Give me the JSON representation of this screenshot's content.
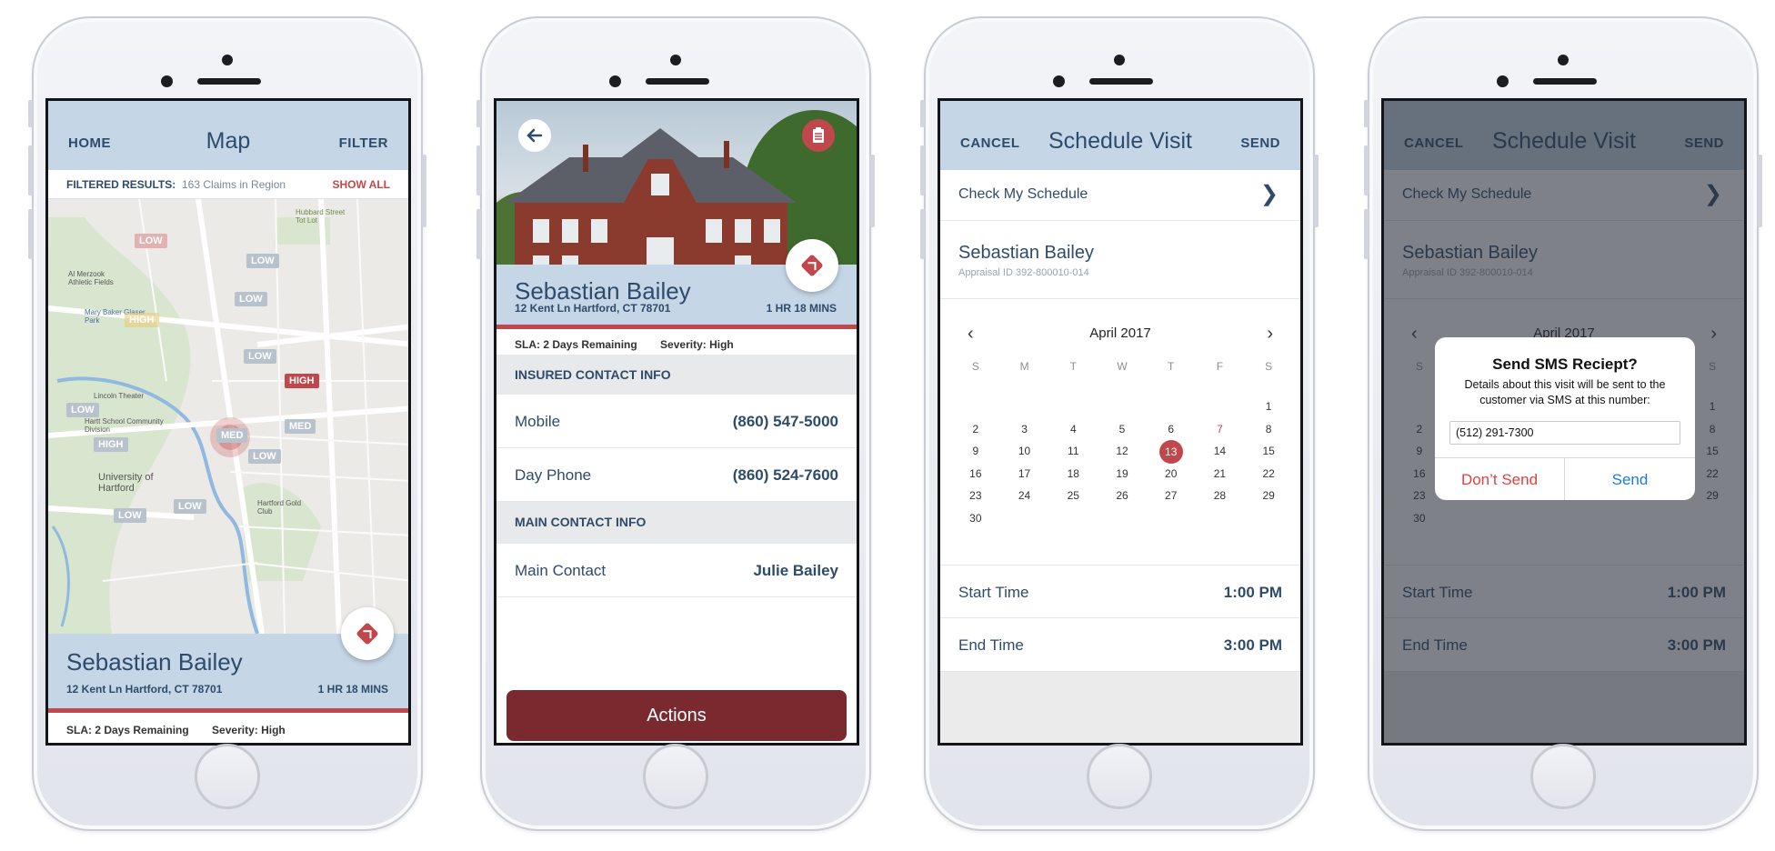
{
  "map_screen": {
    "nav": {
      "left": "HOME",
      "title": "Map",
      "right": "FILTER"
    },
    "filter": {
      "label": "FILTERED RESULTS:",
      "count": "163 Claims in Region",
      "action": "SHOW ALL"
    },
    "map_labels": [
      "Al Merzook Athletic Fields",
      "Hubbard Street Tot Lot",
      "Mary Baker Glaser Park",
      "Lincoln Theater",
      "Hartt School Community Division",
      "University of Hartford",
      "Hartford Gold Club"
    ],
    "pins": [
      "LOW",
      "LOW",
      "LOW",
      "HIGH",
      "LOW",
      "HIGH",
      "LOW",
      "MED",
      "MED",
      "HIGH",
      "LOW",
      "LOW",
      "LOW"
    ],
    "card": {
      "name": "Sebastian Bailey",
      "address": "12 Kent Ln Hartford, CT 78701",
      "eta": "1 HR 18 MINS",
      "sla": "SLA: 2 Days Remaining",
      "severity": "Severity: High"
    }
  },
  "detail_screen": {
    "card": {
      "name": "Sebastian Bailey",
      "address": "12 Kent Ln Hartford, CT 78701",
      "eta": "1 HR 18 MINS",
      "sla": "SLA: 2 Days Remaining",
      "severity": "Severity: High"
    },
    "insured_header": "INSURED CONTACT INFO",
    "mobile": {
      "label": "Mobile",
      "value": "(860) 547-5000"
    },
    "day_phone": {
      "label": "Day Phone",
      "value": "(860) 524-7600"
    },
    "main_header": "MAIN CONTACT INFO",
    "main_contact": {
      "label": "Main Contact",
      "value": "Julie Bailey"
    },
    "actions": "Actions"
  },
  "schedule_screen": {
    "nav": {
      "left": "CANCEL",
      "title": "Schedule Visit",
      "right": "SEND"
    },
    "check_schedule": "Check My Schedule",
    "name": "Sebastian Bailey",
    "appraisal": "Appraisal ID  392-800010-014",
    "month": "April 2017",
    "weekdays": [
      "S",
      "M",
      "T",
      "W",
      "T",
      "F",
      "S"
    ],
    "days": [
      "",
      "",
      "",
      "",
      "",
      "",
      "1",
      "2",
      "3",
      "4",
      "5",
      "6",
      "7",
      "8",
      "9",
      "10",
      "11",
      "12",
      "13",
      "14",
      "15",
      "16",
      "17",
      "18",
      "19",
      "20",
      "21",
      "22",
      "23",
      "24",
      "25",
      "26",
      "27",
      "28",
      "29",
      "30",
      "",
      "",
      "",
      "",
      "",
      ""
    ],
    "selected_day": "13",
    "highlight_day": "7",
    "start_time": {
      "label": "Start Time",
      "value": "1:00 PM"
    },
    "end_time": {
      "label": "End Time",
      "value": "3:00 PM"
    }
  },
  "dialog": {
    "title": "Send SMS Reciept?",
    "message": "Details about this visit will be sent to the customer via SMS at this number:",
    "phone": "(512) 291-7300",
    "cancel": "Don’t Send",
    "confirm": "Send"
  },
  "colors": {
    "navy": "#2f4b6b",
    "accent_red": "#c0474c",
    "nav_blue": "#c5d6e6",
    "actions_button": "#7a2a2e"
  }
}
